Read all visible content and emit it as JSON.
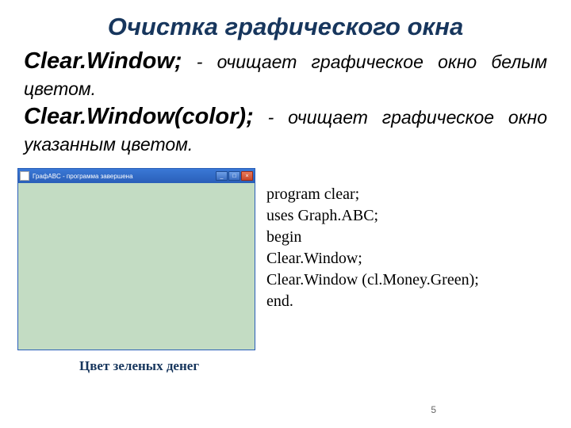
{
  "title": "Очистка графического окна",
  "para1": {
    "proc": "Clear.Window;",
    "desc": " - очищает графическое окно белым цветом."
  },
  "para2": {
    "proc": "Clear.Window(color);",
    "desc": " - очищает графическое окно указанным цветом."
  },
  "window": {
    "title": "ГрафABC - программа завершена",
    "min": "_",
    "max": "□",
    "close": "×"
  },
  "code": {
    "l1": "program clear;",
    "l2": "uses Graph.ABC;",
    "l3": "begin",
    "l4": "Clear.Window;",
    "l5": "Clear.Window (cl.Money.Green);",
    "l6": "end."
  },
  "caption": "Цвет зеленых денег",
  "pagenum": "5"
}
